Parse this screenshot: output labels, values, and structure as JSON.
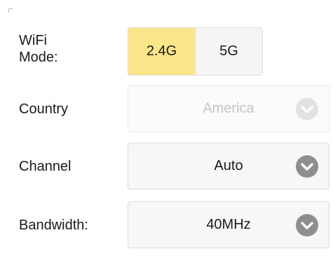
{
  "wifi_mode": {
    "label_line1": "WiFi",
    "label_line2": "Mode:",
    "options": [
      {
        "label": "2.4G",
        "active": true
      },
      {
        "label": "5G",
        "active": false
      }
    ]
  },
  "country": {
    "label": "Country",
    "value": "America",
    "disabled": true
  },
  "channel": {
    "label": "Channel",
    "value": "Auto"
  },
  "bandwidth": {
    "label": "Bandwidth:",
    "value": "40MHz"
  },
  "colors": {
    "active_option": "#fbe789",
    "chevron": "#8e8e8e",
    "chevron_disabled": "#e2e2e2"
  }
}
